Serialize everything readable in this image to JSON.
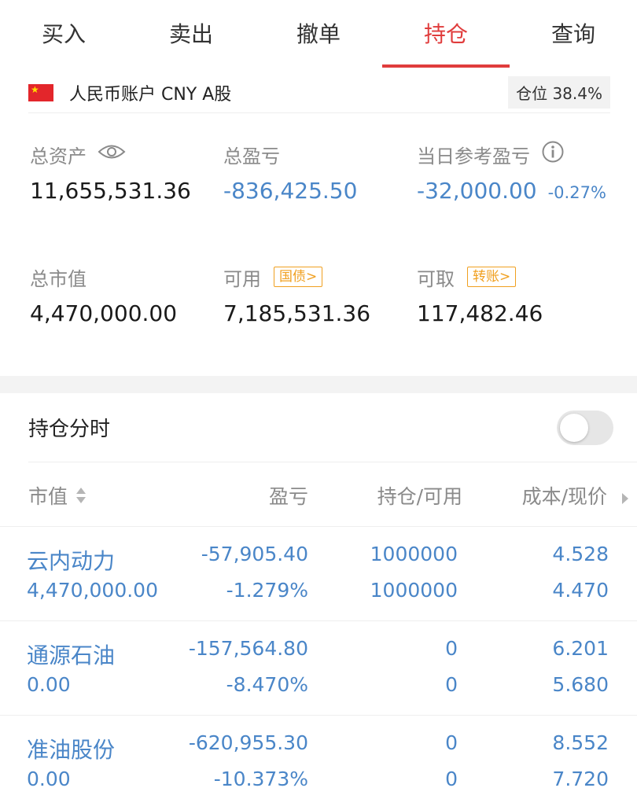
{
  "tabs": [
    "买入",
    "卖出",
    "撤单",
    "持仓",
    "查询"
  ],
  "active_tab": 3,
  "account": {
    "label": "人民币账户 CNY A股",
    "position_label": "仓位",
    "position_value": "38.4%"
  },
  "stats": {
    "total_assets": {
      "label": "总资产",
      "value": "11,655,531.36"
    },
    "total_pl": {
      "label": "总盈亏",
      "value": "-836,425.50"
    },
    "daily_pl": {
      "label": "当日参考盈亏",
      "value": "-32,000.00",
      "pct": "-0.27%"
    },
    "market_value": {
      "label": "总市值",
      "value": "4,470,000.00"
    },
    "available": {
      "label": "可用",
      "tag": "国债>",
      "value": "7,185,531.36"
    },
    "withdrawable": {
      "label": "可取",
      "tag": "转账>",
      "value": "117,482.46"
    }
  },
  "positions_section": {
    "title": "持仓分时",
    "toggle_on": false
  },
  "columns": {
    "market_value": "市值",
    "pl": "盈亏",
    "hold": "持仓/可用",
    "price": "成本/现价"
  },
  "rows": [
    {
      "name": "云内动力",
      "market_value": "4,470,000.00",
      "pl": "-57,905.40",
      "pl_pct": "-1.279%",
      "hold": "1000000",
      "avail": "1000000",
      "cost": "4.528",
      "price": "4.470"
    },
    {
      "name": "通源石油",
      "market_value": "0.00",
      "pl": "-157,564.80",
      "pl_pct": "-8.470%",
      "hold": "0",
      "avail": "0",
      "cost": "6.201",
      "price": "5.680"
    },
    {
      "name": "准油股份",
      "market_value": "0.00",
      "pl": "-620,955.30",
      "pl_pct": "-10.373%",
      "hold": "0",
      "avail": "0",
      "cost": "8.552",
      "price": "7.720"
    }
  ],
  "colors": {
    "accent": "#e03c3c",
    "loss_blue": "#4a86c8",
    "tag_orange": "#f0a020"
  }
}
